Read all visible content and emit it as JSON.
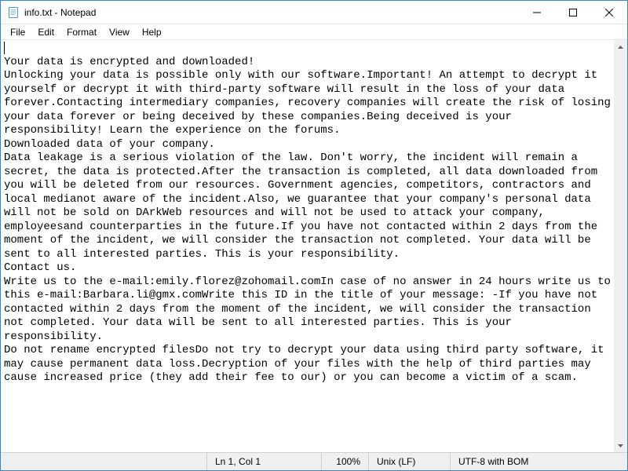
{
  "window": {
    "title": "info.txt - Notepad"
  },
  "menu": {
    "file": "File",
    "edit": "Edit",
    "format": "Format",
    "view": "View",
    "help": "Help"
  },
  "content": {
    "text": "\nYour data is encrypted and downloaded!\nUnlocking your data is possible only with our software.Important! An attempt to decrypt it yourself or decrypt it with third-party software will result in the loss of your data forever.Contacting intermediary companies, recovery companies will create the risk of losing your data forever or being deceived by these companies.Being deceived is your responsibility! Learn the experience on the forums.\nDownloaded data of your company.\nData leakage is a serious violation of the law. Don't worry, the incident will remain a secret, the data is protected.After the transaction is completed, all data downloaded from you will be deleted from our resources. Government agencies, competitors, contractors and local medianot aware of the incident.Also, we guarantee that your company's personal data will not be sold on DArkWeb resources and will not be used to attack your company, employeesand counterparties in the future.If you have not contacted within 2 days from the moment of the incident, we will consider the transaction not completed. Your data will be sent to all interested parties. This is your responsibility.\nContact us.\nWrite us to the e-mail:emily.florez@zohomail.comIn case of no answer in 24 hours write us to this e-mail:Barbara.li@gmx.comWrite this ID in the title of your message: -If you have not contacted within 2 days from the moment of the incident, we will consider the transaction not completed. Your data will be sent to all interested parties. This is your responsibility.\nDo not rename encrypted filesDo not try to decrypt your data using third party software, it may cause permanent data loss.Decryption of your files with the help of third parties may cause increased price (they add their fee to our) or you can become a victim of a scam.\n"
  },
  "status": {
    "lncol": "Ln 1, Col 1",
    "zoom": "100%",
    "eol": "Unix (LF)",
    "encoding": "UTF-8 with BOM"
  }
}
